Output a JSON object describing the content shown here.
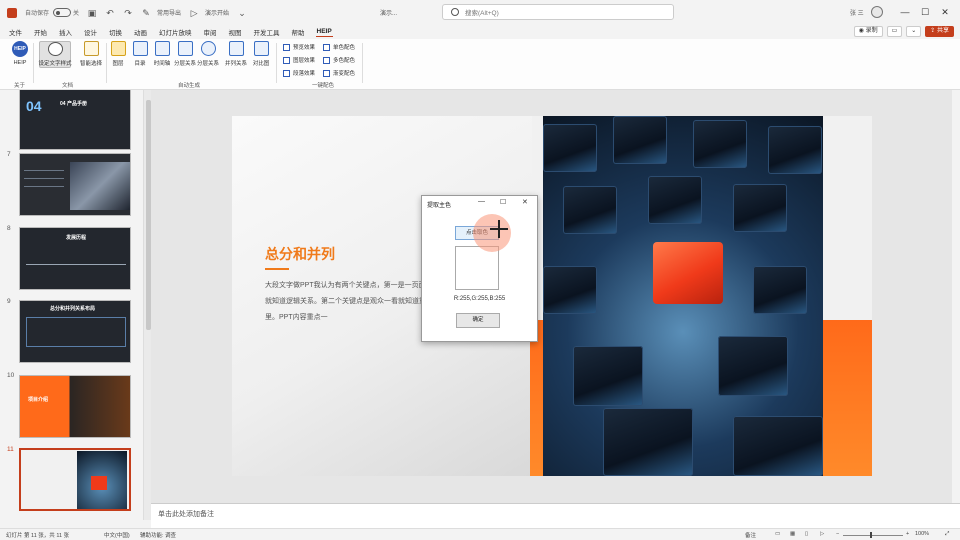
{
  "titlebar": {
    "autosave_label": "自动保存",
    "autosave_state": "关",
    "quick_access_text": "常用导出",
    "quick_access_text2": "演示开始",
    "file_name": "演示...",
    "search_placeholder": "搜索(Alt+Q)",
    "user_name": "张 三"
  },
  "ribbon": {
    "tabs": [
      "文件",
      "开始",
      "插入",
      "设计",
      "切换",
      "动画",
      "幻灯片放映",
      "审阅",
      "视图",
      "开发工具",
      "帮助",
      "HEIP"
    ],
    "active_tab": "HEIP",
    "record_label": "录制",
    "share_label": "共享",
    "buttons": {
      "helper": "HEIP",
      "helper_logo": "HEIP",
      "text_style": "设定文字样式",
      "auto_choose": "智能选择",
      "layer": "图层",
      "catalog": "目录",
      "timeline": "时间轴",
      "relation": "分层关系",
      "parallel": "并列关系",
      "compare": "对比图"
    },
    "checks": [
      "预览效果",
      "图层效果",
      "段落效果",
      "单色配色",
      "多色配色",
      "渐变配色"
    ],
    "groups": {
      "about": "关于",
      "text": "文档",
      "auto_gen": "自动生成",
      "quick_color": "一键配色"
    }
  },
  "thumbnails": [
    {
      "num": "",
      "title": "04  产品手册"
    },
    {
      "num": "7",
      "title": ""
    },
    {
      "num": "8",
      "title": "发展历程"
    },
    {
      "num": "9",
      "title": "总分和并列关系布局"
    },
    {
      "num": "10",
      "title": "项目介绍"
    },
    {
      "num": "11",
      "title": ""
    }
  ],
  "slide": {
    "title": "总分和并列",
    "body": "大段文字做PPT我认为有两个关键点，第一是一页面中的图形就知道逻辑关系。第二个关键点是观众一看就知道重点在哪里。PPT内容重点一"
  },
  "dialog": {
    "title": "提取主色",
    "minimize": "—",
    "maximize": "☐",
    "close": "✕",
    "pick_button": "点击取色",
    "rgb_readout": "R:255,G:255,B:255",
    "ok_button": "确定",
    "preview_color": "#ffffff"
  },
  "notes": {
    "placeholder": "单击此处添加备注"
  },
  "statusbar": {
    "slide_info": "幻灯片 第 11 张，共 11 张",
    "language": "中文(中国)",
    "accessibility": "辅助功能: 调查",
    "notes_label": "备注",
    "zoom": "100%"
  },
  "colors": {
    "accent": "#c43e1c",
    "slide_orange": "#f07a1a",
    "helper_blue": "#2f5bb7"
  }
}
